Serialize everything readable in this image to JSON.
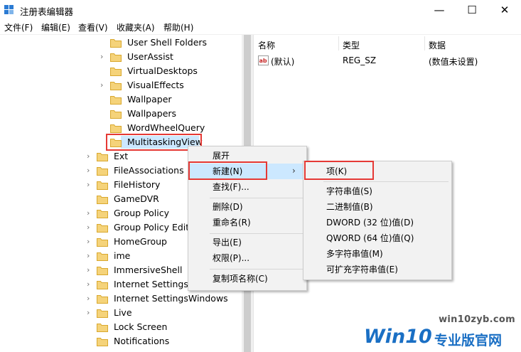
{
  "window": {
    "title": "注册表编辑器",
    "minimize": "—",
    "maximize": "☐",
    "close": "✕"
  },
  "menu": [
    "文件(F)",
    "编辑(E)",
    "查看(V)",
    "收藏夹(A)",
    "帮助(H)"
  ],
  "tree": {
    "level2": [
      "User Shell Folders",
      "UserAssist",
      "VirtualDesktops",
      "VisualEffects",
      "Wallpaper",
      "Wallpapers",
      "WordWheelQuery",
      "MultitaskingView"
    ],
    "level2_expandable": [
      false,
      true,
      false,
      true,
      false,
      false,
      false,
      false
    ],
    "level1": [
      "Ext",
      "FileAssociations",
      "FileHistory",
      "GameDVR",
      "Group Policy",
      "Group Policy Edito",
      "HomeGroup",
      "ime",
      "ImmersiveShell",
      "Internet Settings",
      "Internet SettingsWindows",
      "Live",
      "Lock Screen",
      "Notifications"
    ],
    "level1_expandable": [
      true,
      true,
      true,
      false,
      true,
      true,
      true,
      true,
      true,
      true,
      true,
      true,
      false,
      false
    ]
  },
  "columns": {
    "name": "名称",
    "type": "类型",
    "data": "数据"
  },
  "values": [
    {
      "name": "(默认)",
      "type": "REG_SZ",
      "data": "(数值未设置)"
    }
  ],
  "context_menu": {
    "expand": "展开",
    "new": "新建(N)",
    "find": "查找(F)...",
    "delete": "删除(D)",
    "rename": "重命名(R)",
    "export": "导出(E)",
    "permissions": "权限(P)...",
    "copy_key_name": "复制项名称(C)"
  },
  "submenu": {
    "key": "项(K)",
    "string": "字符串值(S)",
    "binary": "二进制值(B)",
    "dword": "DWORD (32 位)值(D)",
    "qword": "QWORD (64 位)值(Q)",
    "multi_string": "多字符串值(M)",
    "expand_string": "可扩充字符串值(E)"
  },
  "watermark": {
    "url": "win10zyb.com",
    "logo": "Win10",
    "text": "专业版官网"
  },
  "colors": {
    "highlight": "#cce8ff",
    "annotation_red": "#e53935",
    "folder": "#f5d37a",
    "brand_blue": "#1a6fc4"
  }
}
